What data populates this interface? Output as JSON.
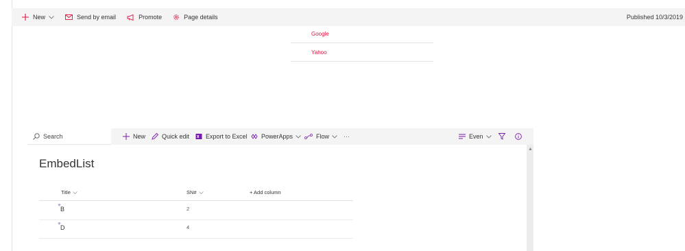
{
  "top_bar": {
    "new_label": "New",
    "send_email_label": "Send by email",
    "promote_label": "Promote",
    "page_details_label": "Page details",
    "published_label": "Published 10/3/2019"
  },
  "quick_links": [
    "Google",
    "Yahoo"
  ],
  "list_bar": {
    "search_placeholder": "Search",
    "new_label": "New",
    "quick_edit_label": "Quick edit",
    "export_label": "Export to Excel",
    "powerapps_label": "PowerApps",
    "flow_label": "Flow",
    "more_label": "···",
    "view_label": "Even"
  },
  "list": {
    "title": "EmbedList",
    "columns": {
      "title": "Title",
      "sn": "SN#",
      "add": "+ Add column"
    },
    "rows": [
      {
        "title": "B",
        "sn": "2"
      },
      {
        "title": "D",
        "sn": "4"
      }
    ]
  },
  "colors": {
    "accent": "#e0123a",
    "brand": "#7719aa",
    "link": "#e0123a"
  }
}
